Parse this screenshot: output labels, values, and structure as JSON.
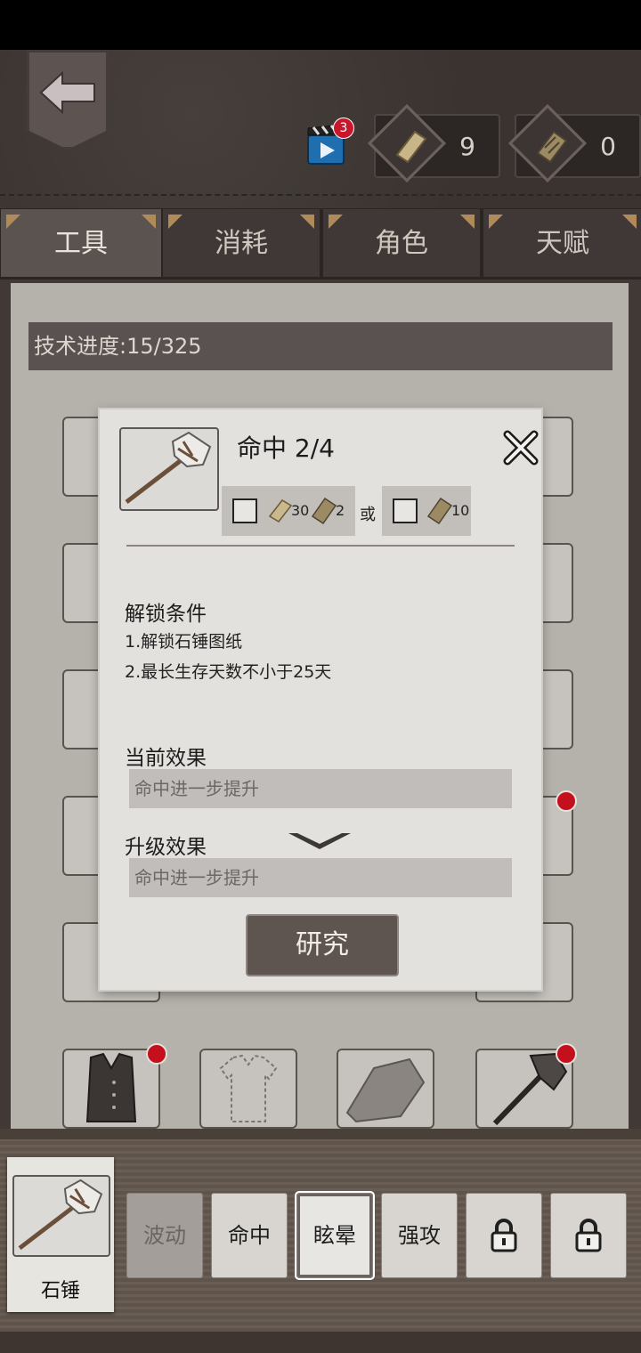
{
  "header": {
    "video_badge_count": "3",
    "resources": [
      {
        "name": "scroll",
        "value": "9"
      },
      {
        "name": "blueprint",
        "value": "0"
      }
    ]
  },
  "tabs": [
    {
      "label": "工具",
      "active": true
    },
    {
      "label": "消耗",
      "active": false
    },
    {
      "label": "角色",
      "active": false
    },
    {
      "label": "天赋",
      "active": false
    }
  ],
  "tech_progress": "技术进度:15/325",
  "dialog": {
    "title": "命中 2/4",
    "cost_option_1": {
      "scroll_cost": "30",
      "blueprint_cost": "2"
    },
    "or_label": "或",
    "cost_option_2": {
      "blueprint_cost": "10"
    },
    "unlock_title": "解锁条件",
    "conditions": [
      "1.解锁石锤图纸",
      "2.最长生存天数不小于25天"
    ],
    "current_effect_title": "当前效果",
    "current_effect": "命中进一步提升",
    "upgrade_effect_title": "升级效果",
    "upgrade_effect": "命中进一步提升",
    "research_button": "研究"
  },
  "selected_item": {
    "label": "石锤"
  },
  "skills": [
    {
      "label": "波动",
      "state": "disabled"
    },
    {
      "label": "命中",
      "state": "normal"
    },
    {
      "label": "眩晕",
      "state": "active"
    },
    {
      "label": "强攻",
      "state": "normal"
    },
    {
      "label": "",
      "state": "locked"
    },
    {
      "label": "",
      "state": "locked"
    }
  ],
  "colors": {
    "accent": "#b18a5a",
    "notify_red": "#c4101c",
    "panel_dark": "#3e3734"
  }
}
